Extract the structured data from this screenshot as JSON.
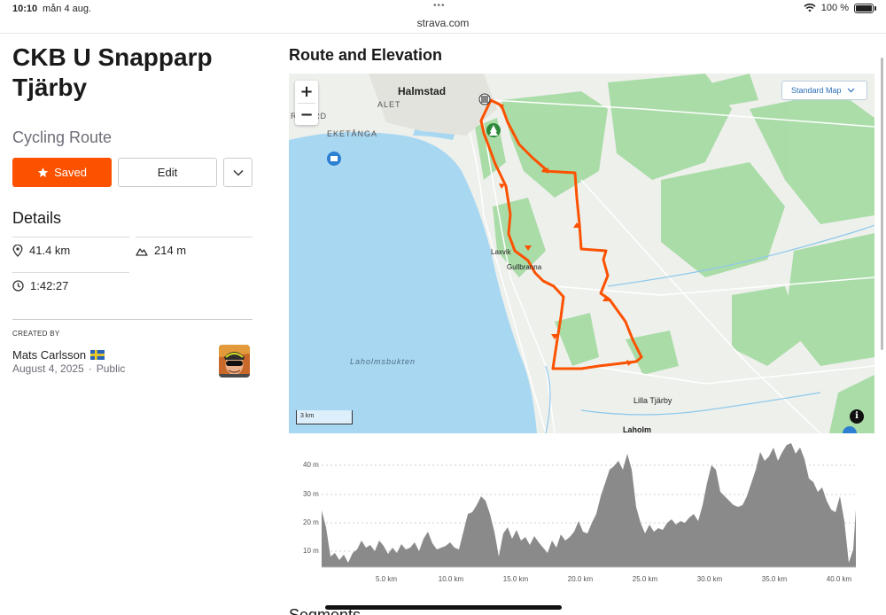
{
  "status_bar": {
    "time": "10:10",
    "date": "mån 4 aug.",
    "url": "strava.com",
    "battery": "100 %"
  },
  "route": {
    "title": "CKB U Snapparp Tjärby",
    "type": "Cycling Route",
    "saved_label": "Saved",
    "edit_label": "Edit"
  },
  "details": {
    "title": "Details",
    "distance": "41.4 km",
    "elevation": "214 m",
    "time": "1:42:27"
  },
  "creator": {
    "heading": "CREATED BY",
    "name": "Mats Carlsson",
    "date": "August 4, 2025",
    "separator": "·",
    "visibility": "Public"
  },
  "route_section": {
    "title": "Route and Elevation"
  },
  "map": {
    "type_label": "Standard Map",
    "zoom_in": "+",
    "zoom_out": "−",
    "scale_label": "3 km",
    "labels": {
      "halmstad": "Halmstad",
      "alet": "ALET",
      "rgard": "R  GÅRD",
      "eketanga": "EKETÅNGA",
      "laxvik": "Laxvik",
      "gullbranna": "Gullbranna",
      "laholmsbukten": "Laholmsbukten",
      "lilla_tjarby": "Lilla Tjärby",
      "laholm": "Laholm"
    },
    "colors": {
      "water": "#a8d7f2",
      "forest": "#a7dba5",
      "route": "#fc5200"
    }
  },
  "elevation_chart": {
    "y_ticks": [
      "40 m",
      "30 m",
      "20 m",
      "10 m"
    ],
    "x_ticks": [
      "5.0 km",
      "10.0 km",
      "15.0 km",
      "20.0 km",
      "25.0 km",
      "30.0 km",
      "35.0 km",
      "40.0 km"
    ]
  },
  "next_section": {
    "title": "Segments"
  }
}
